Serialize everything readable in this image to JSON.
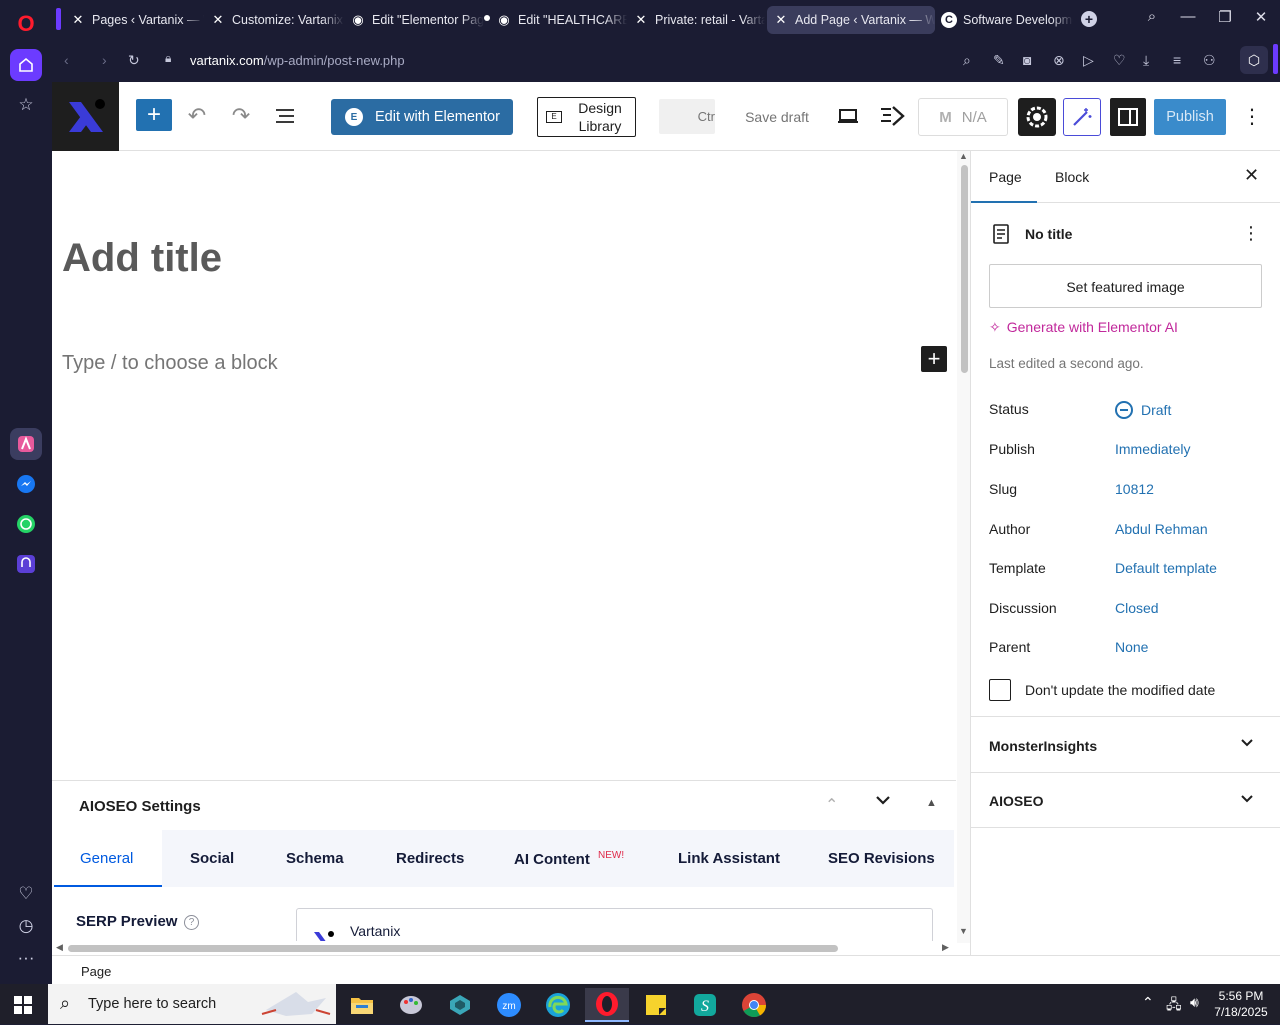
{
  "browser": {
    "tabs": [
      {
        "label": "Pages ‹ Vartanix — W",
        "icon": "x-logo"
      },
      {
        "label": "Customize: Vartanix |",
        "icon": "x-logo"
      },
      {
        "label": "Edit \"Elementor Page",
        "icon": "globe"
      },
      {
        "label": "Edit \"HEALTHCARE\"",
        "icon": "globe"
      },
      {
        "label": "Private: retail - Varta",
        "icon": "x-logo"
      },
      {
        "label": "Add Page ‹ Vartanix — Wo",
        "icon": "x-logo",
        "active": true
      },
      {
        "label": "Software Developme",
        "icon": "c-logo"
      }
    ],
    "url_domain": "vartanix.com",
    "url_path": "/wp-admin/post-new.php"
  },
  "toolbar": {
    "edit_elementor_label": "Edit with Elementor",
    "design_library_label": "Design Library",
    "ctrl_label": "Ctr",
    "save_draft_label": "Save draft",
    "na_label": "N/A",
    "publish_label": "Publish"
  },
  "editor": {
    "title_placeholder": "Add title",
    "block_placeholder": "Type / to choose a block"
  },
  "sidebar": {
    "tab_page": "Page",
    "tab_block": "Block",
    "doc_title": "No title",
    "featured_image_label": "Set featured image",
    "generate_ai_label": "Generate with Elementor AI",
    "last_edited": "Last edited a second ago.",
    "meta": [
      {
        "label": "Status",
        "value": "Draft"
      },
      {
        "label": "Publish",
        "value": "Immediately"
      },
      {
        "label": "Slug",
        "value": "10812"
      },
      {
        "label": "Author",
        "value": "Abdul Rehman"
      },
      {
        "label": "Template",
        "value": "Default template"
      },
      {
        "label": "Discussion",
        "value": "Closed"
      },
      {
        "label": "Parent",
        "value": "None"
      }
    ],
    "modified_date_label": "Don't update the modified date",
    "panels": [
      "MonsterInsights",
      "AIOSEO"
    ]
  },
  "aioseo": {
    "heading": "AIOSEO Settings",
    "tabs": [
      "General",
      "Social",
      "Schema",
      "Redirects",
      "AI Content",
      "Link Assistant",
      "SEO Revisions"
    ],
    "new_badge": "NEW!",
    "serp_label": "SERP Preview",
    "serp_site": "Vartanix"
  },
  "statusbar": {
    "breadcrumb": "Page"
  },
  "taskbar": {
    "search_placeholder": "Type here to search",
    "time": "5:56 PM",
    "date": "7/18/2025"
  },
  "colors": {
    "wp_blue": "#2271b1",
    "elementor_blue": "#2b6ca3",
    "ai_pink": "#c1289b",
    "opera_red": "#ff1b2d"
  }
}
